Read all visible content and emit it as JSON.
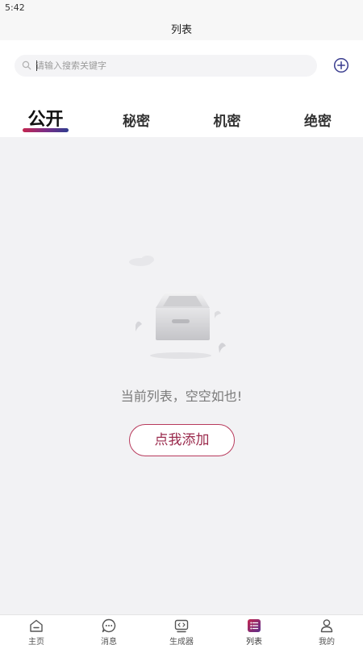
{
  "status_bar": {
    "time": "5:42"
  },
  "header": {
    "title": "列表"
  },
  "search": {
    "placeholder": "请输入搜索关键字",
    "value": ""
  },
  "tabs": [
    {
      "label": "公开",
      "active": true
    },
    {
      "label": "秘密",
      "active": false
    },
    {
      "label": "机密",
      "active": false
    },
    {
      "label": "绝密",
      "active": false
    }
  ],
  "empty_state": {
    "message": "当前列表，空空如也!",
    "add_button_label": "点我添加"
  },
  "bottom_nav": [
    {
      "label": "主页",
      "icon": "home-icon",
      "active": false
    },
    {
      "label": "消息",
      "icon": "message-icon",
      "active": false
    },
    {
      "label": "生成器",
      "icon": "generator-icon",
      "active": false
    },
    {
      "label": "列表",
      "icon": "list-icon",
      "active": true
    },
    {
      "label": "我的",
      "icon": "profile-icon",
      "active": false
    }
  ],
  "colors": {
    "accent": "#9a2a4c",
    "tab_underline_start": "#c4264f",
    "tab_underline_end": "#2f3c8f",
    "active_nav": "#7b2d86"
  }
}
